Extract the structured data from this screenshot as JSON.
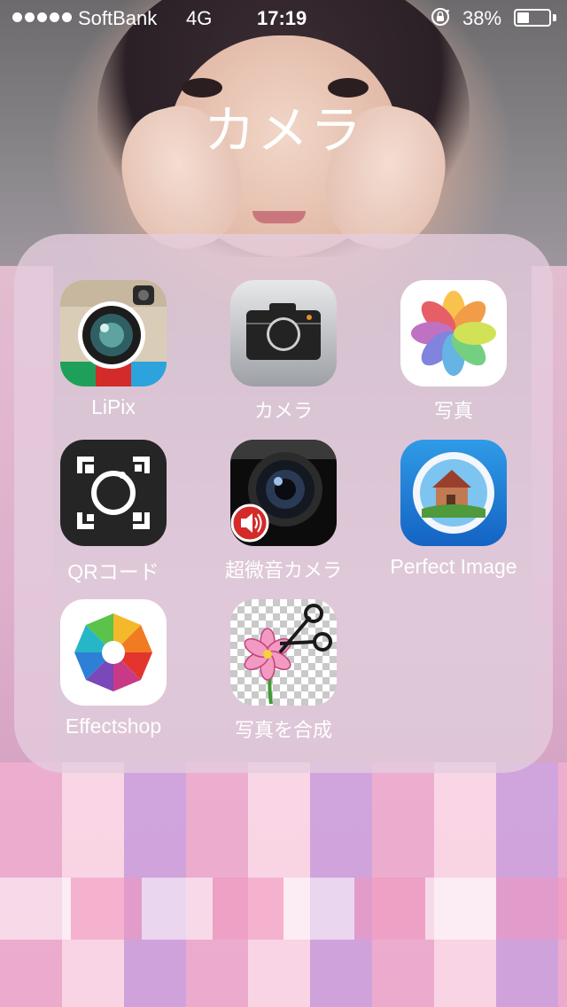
{
  "status_bar": {
    "carrier": "SoftBank",
    "network": "4G",
    "time": "17:19",
    "battery_percent": "38%",
    "battery_level": 0.38,
    "signal_dots": 5,
    "icons": [
      "signal-dots-icon",
      "rotation-lock-icon",
      "battery-icon"
    ]
  },
  "folder": {
    "title": "カメラ",
    "apps": [
      {
        "label": "LiPix",
        "icon": "lipix-icon"
      },
      {
        "label": "カメラ",
        "icon": "camera-app-icon"
      },
      {
        "label": "写真",
        "icon": "photos-app-icon"
      },
      {
        "label": "QRコード",
        "icon": "qr-code-app-icon"
      },
      {
        "label": "超微音カメラ",
        "icon": "silent-camera-app-icon"
      },
      {
        "label": "Perfect Image",
        "icon": "perfect-image-app-icon"
      },
      {
        "label": "Effectshop",
        "icon": "effectshop-app-icon"
      },
      {
        "label": "写真を合成",
        "icon": "photo-compose-app-icon"
      }
    ]
  },
  "colors": {
    "text": "#ffffff",
    "folder_background": "#e4cdde"
  }
}
